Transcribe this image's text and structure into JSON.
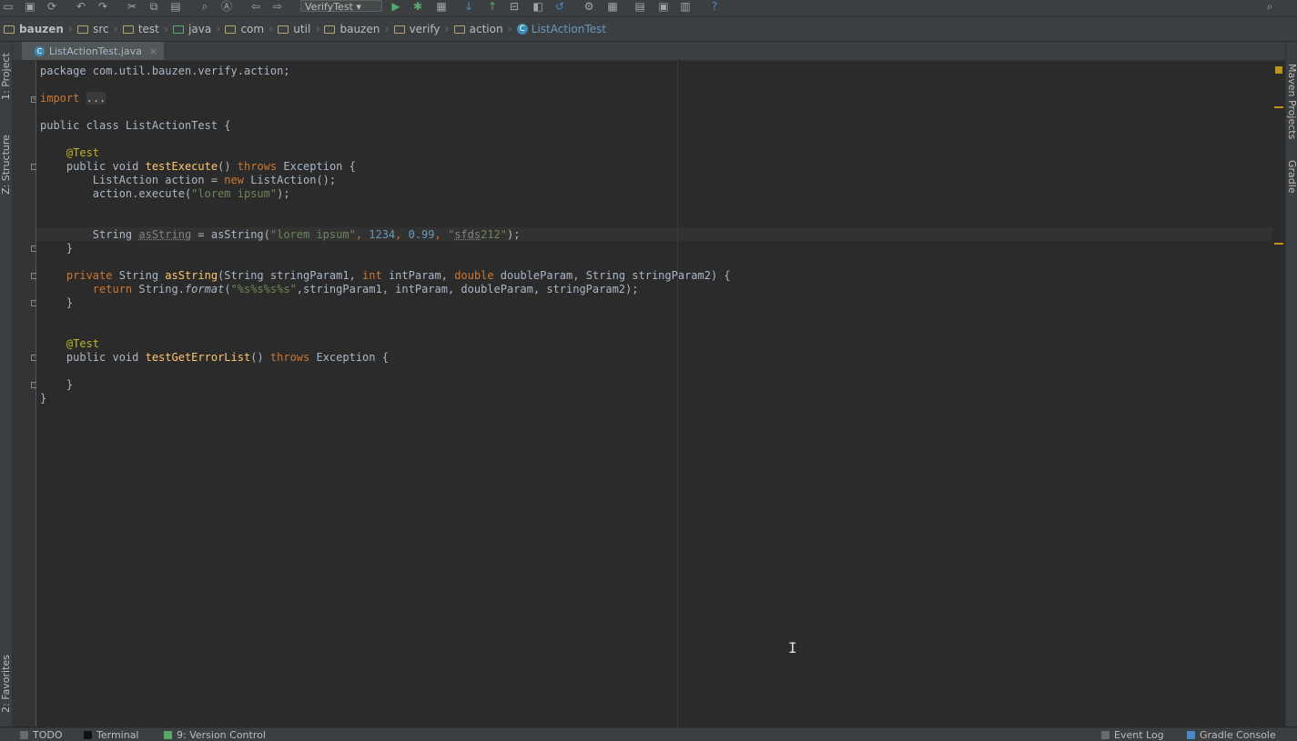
{
  "run_config": "VerifyTest",
  "breadcrumbs": [
    "bauzen",
    "src",
    "test",
    "java",
    "com",
    "util",
    "bauzen",
    "verify",
    "action"
  ],
  "breadcrumb_class": "ListActionTest",
  "editor_tab": {
    "label": "ListActionTest.java",
    "close": "×"
  },
  "left_tool_tabs": {
    "project": "1: Project",
    "structure": "Z: Structure",
    "favorites": "2: Favorites"
  },
  "right_tool_tabs": {
    "maven": "Maven Projects",
    "gradle": "Gradle"
  },
  "code": {
    "l1": "package com.util.bauzen.verify.action;",
    "import_kw": "import",
    "import_fold": "...",
    "class_decl": "public class ListActionTest {",
    "ann1": "@Test",
    "m1_public": "public void ",
    "m1_name": "testExecute",
    "m1_throws": "throws",
    "m1_rest": " Exception {",
    "l_action1": "ListAction action = ",
    "l_action_new": "new",
    "l_action_rest": " ListAction();",
    "l_exec1": "action.execute(",
    "l_exec_str": "\"lorem ipsum\"",
    "l_exec_end": ");",
    "l_str_type": "String ",
    "l_str_var": "asString",
    "l_str_call": " = asString(",
    "l_str_s1": "\"lorem ipsum\"",
    "l_str_n1": "1234",
    "l_str_n2": "0.99",
    "l_str_s2a": "\"",
    "l_str_s2b": "sfds",
    "l_str_s2c": "212\"",
    "l_str_end": ");",
    "close_brace": "}",
    "m2_private": "private",
    "m2_type": " String ",
    "m2_name": "asString",
    "m2_p1": "(String stringParam1, ",
    "m2_int": "int",
    "m2_p2": " intParam, ",
    "m2_double": "double",
    "m2_p3": " doubleParam, String stringParam2) {",
    "ret_kw": "return",
    "ret_cls": " String.",
    "ret_fmt": "format",
    "ret_open": "(",
    "ret_str": "\"%s%s%s%s\"",
    "ret_args": ",stringParam1, intParam, doubleParam, stringParam2);",
    "ann2": "@Test",
    "m3_public": "public void ",
    "m3_name": "testGetErrorList",
    "m3_mid": "() ",
    "m3_throws": "throws",
    "m3_rest": " Exception {"
  },
  "status": {
    "todo": "TODO",
    "terminal": "Terminal",
    "vcs": "9: Version Control",
    "event_log": "Event Log",
    "gradle_console": "Gradle Console"
  },
  "icons": [
    "save-icon",
    "sync-icon",
    "undo-icon",
    "redo-icon",
    "cut-icon",
    "copy-icon",
    "paste-icon",
    "find-icon",
    "replace-icon",
    "back-icon",
    "forward-icon",
    "run-icon",
    "debug-icon",
    "coverage-icon",
    "vcs-update-icon",
    "vcs-commit-icon",
    "help-icon",
    "search-everywhere-icon"
  ],
  "colors": {
    "keyword": "#cc7832",
    "string": "#6a8759",
    "number": "#6897bb",
    "annotation": "#bbb529",
    "method": "#ffc66d",
    "background": "#2b2b2b"
  }
}
